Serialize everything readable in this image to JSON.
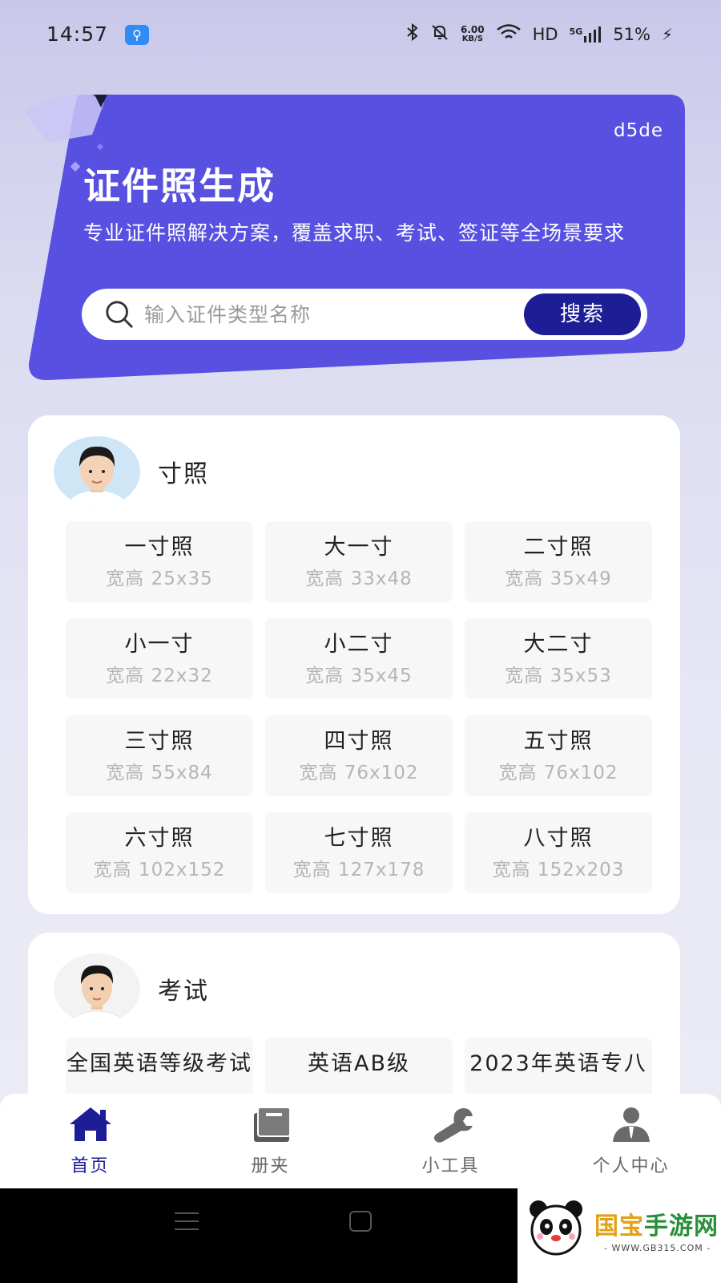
{
  "status_bar": {
    "time": "14:57",
    "usb_icon": "usb-icon",
    "net_speed_value": "6.00",
    "net_speed_unit": "KB/S",
    "hd": "HD",
    "signal": "5G",
    "battery": "51%"
  },
  "hero": {
    "user_id": "d5de",
    "title": "证件照生成",
    "description": "专业证件照解决方案，覆盖求职、考试、签证等全场景要求",
    "search": {
      "placeholder": "输入证件类型名称",
      "button_label": "搜索"
    },
    "colors": {
      "banner": "#5750e0",
      "button": "#1d1d96"
    }
  },
  "sections": [
    {
      "title": "寸照",
      "items": [
        {
          "name": "一寸照",
          "size": "宽高 25x35"
        },
        {
          "name": "大一寸",
          "size": "宽高 33x48"
        },
        {
          "name": "二寸照",
          "size": "宽高 35x49"
        },
        {
          "name": "小一寸",
          "size": "宽高 22x32"
        },
        {
          "name": "小二寸",
          "size": "宽高 35x45"
        },
        {
          "name": "大二寸",
          "size": "宽高 35x53"
        },
        {
          "name": "三寸照",
          "size": "宽高 55x84"
        },
        {
          "name": "四寸照",
          "size": "宽高 76x102"
        },
        {
          "name": "五寸照",
          "size": "宽高 76x102"
        },
        {
          "name": "六寸照",
          "size": "宽高 102x152"
        },
        {
          "name": "七寸照",
          "size": "宽高 127x178"
        },
        {
          "name": "八寸照",
          "size": "宽高 152x203"
        }
      ]
    },
    {
      "title": "考试",
      "items": [
        {
          "name": "全国英语等级考试"
        },
        {
          "name": "英语AB级"
        },
        {
          "name": "2023年英语专八"
        }
      ]
    }
  ],
  "bottom_nav": [
    {
      "label": "首页",
      "icon": "home-icon",
      "active": true
    },
    {
      "label": "册夹",
      "icon": "album-icon",
      "active": false
    },
    {
      "label": "小工具",
      "icon": "wrench-icon",
      "active": false
    },
    {
      "label": "个人中心",
      "icon": "user-icon",
      "active": false
    }
  ],
  "watermark": {
    "brand_part1": "国宝",
    "brand_part2": "手游网",
    "url": "- WWW.GB315.COM -"
  }
}
